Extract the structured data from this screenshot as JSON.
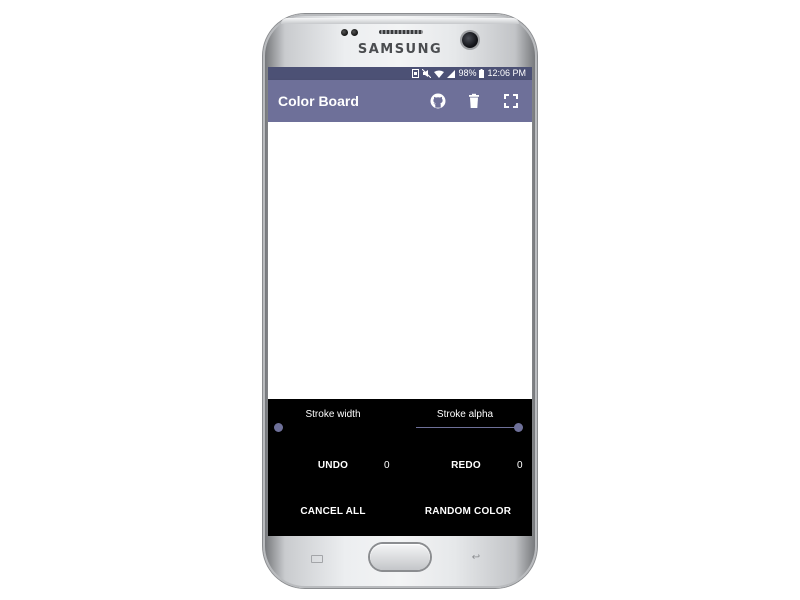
{
  "device": {
    "brand": "SAMSUNG"
  },
  "status_bar": {
    "battery": "98%",
    "time": "12:06 PM",
    "icons": [
      "sync-icon",
      "mute-icon",
      "wifi-icon",
      "signal-icon",
      "battery-icon"
    ]
  },
  "app_bar": {
    "title": "Color Board",
    "actions": [
      "github-icon",
      "delete-icon",
      "fullscreen-icon"
    ],
    "color": "#6e7099"
  },
  "controls": {
    "stroke_width_label": "Stroke width",
    "stroke_alpha_label": "Stroke alpha",
    "stroke_width_value": 0,
    "stroke_alpha_value": 1,
    "undo_label": "UNDO",
    "undo_count": "0",
    "redo_label": "REDO",
    "redo_count": "0",
    "cancel_all_label": "CANCEL ALL",
    "random_color_label": "RANDOM COLOR",
    "accent": "#6e7099",
    "background": "#000000"
  }
}
